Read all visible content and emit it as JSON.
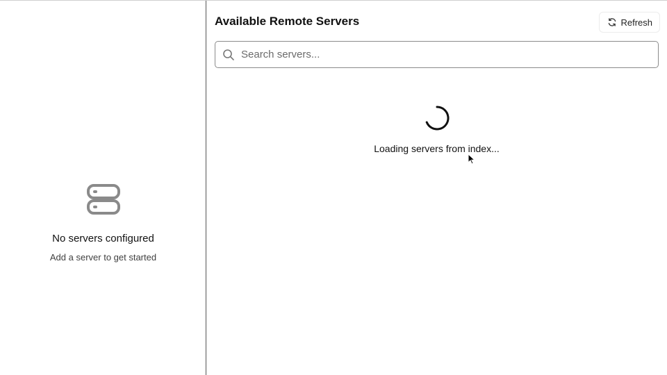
{
  "left_panel": {
    "empty_icon": "server-stack-icon",
    "empty_title": "No servers configured",
    "empty_subtitle": "Add a server to get started"
  },
  "right_panel": {
    "title": "Available Remote Servers",
    "refresh": {
      "icon": "refresh-icon",
      "label": "Refresh"
    },
    "search": {
      "icon": "search-icon",
      "placeholder": "Search servers...",
      "value": ""
    },
    "loading": {
      "icon": "spinner-icon",
      "text": "Loading servers from index..."
    }
  },
  "colors": {
    "divider": "#555555",
    "muted_icon": "#8a8a8a",
    "text": "#111111"
  }
}
